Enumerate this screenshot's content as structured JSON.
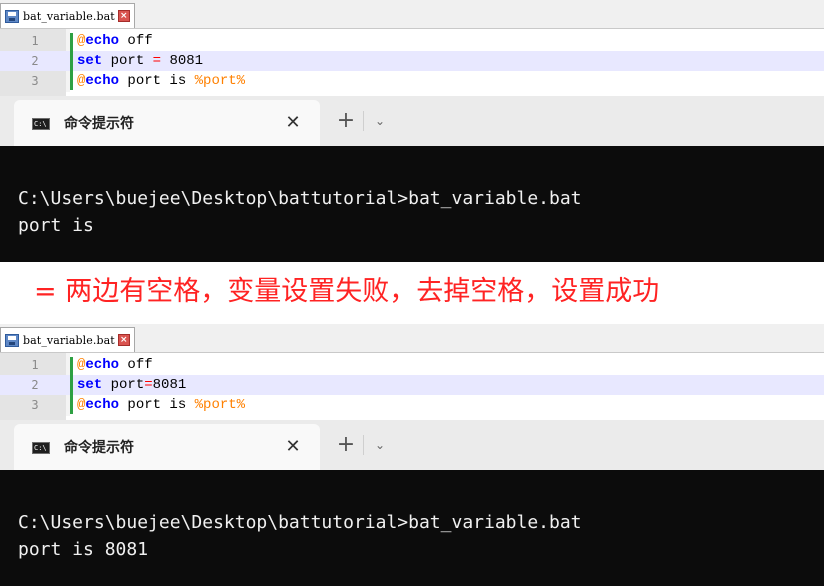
{
  "top": {
    "file_tab": {
      "name": "bat_variable.bat",
      "close": "×"
    },
    "lines": [
      {
        "num": "1",
        "parts": [
          "@",
          "echo",
          " off"
        ]
      },
      {
        "num": "2",
        "parts": [
          "set",
          " port ",
          "=",
          " 8081"
        ]
      },
      {
        "num": "3",
        "parts": [
          "@",
          "echo",
          " port is ",
          "%port%"
        ]
      }
    ],
    "terminal_tab": {
      "title": "命令提示符",
      "close": "✕",
      "new": "+",
      "dropdown": "⌄",
      "icon_text": "C:\\"
    },
    "terminal_lines": [
      "C:\\Users\\buejee\\Desktop\\battutorial>bat_variable.bat",
      "port is"
    ]
  },
  "caption": "= 两边有空格，变量设置失败，去掉空格，设置成功",
  "bottom": {
    "file_tab": {
      "name": "bat_variable.bat",
      "close": "×"
    },
    "lines": [
      {
        "num": "1",
        "parts": [
          "@",
          "echo",
          " off"
        ]
      },
      {
        "num": "2",
        "parts": [
          "set",
          " port",
          "=",
          "8081"
        ]
      },
      {
        "num": "3",
        "parts": [
          "@",
          "echo",
          " port is ",
          "%port%"
        ]
      }
    ],
    "terminal_tab": {
      "title": "命令提示符",
      "close": "✕",
      "new": "+",
      "dropdown": "⌄",
      "icon_text": "C:\\"
    },
    "terminal_lines": [
      "C:\\Users\\buejee\\Desktop\\battutorial>bat_variable.bat",
      "port is 8081"
    ]
  }
}
